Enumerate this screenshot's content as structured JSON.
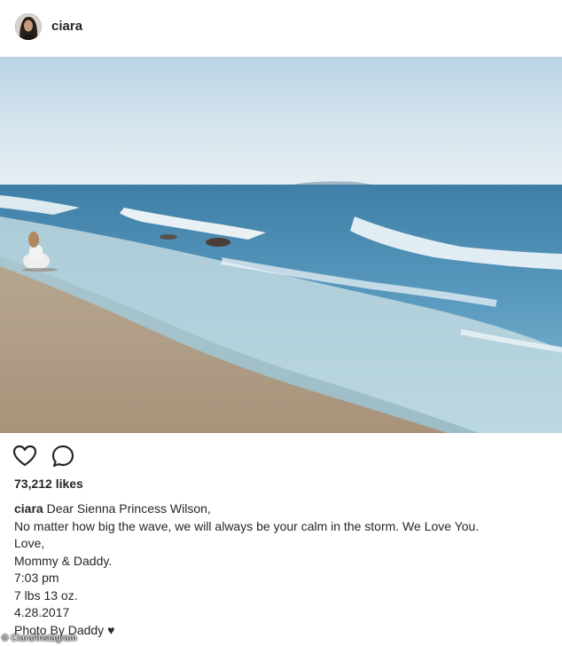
{
  "post": {
    "username": "ciara",
    "likes": "73,212 likes",
    "caption": {
      "author": "ciara",
      "first_line": "Dear Sienna Princess Wilson,",
      "lines": [
        "No matter how big the wave, we will always be your calm in the storm. We Love You.",
        "Love,",
        "Mommy & Daddy.",
        "7:03 pm",
        "7 lbs 13 oz.",
        "4.28.2017",
        "Photo By Daddy"
      ],
      "heart_glyph": "♥"
    },
    "photo_credit": "© Ciara/Instagram"
  },
  "icons": {
    "like": "heart-outline-icon",
    "comment": "speech-bubble-icon"
  },
  "colors": {
    "text": "#262626",
    "sky": "#cfe0ea",
    "sea": "#4b8db5",
    "sand": "#b9a48a"
  }
}
